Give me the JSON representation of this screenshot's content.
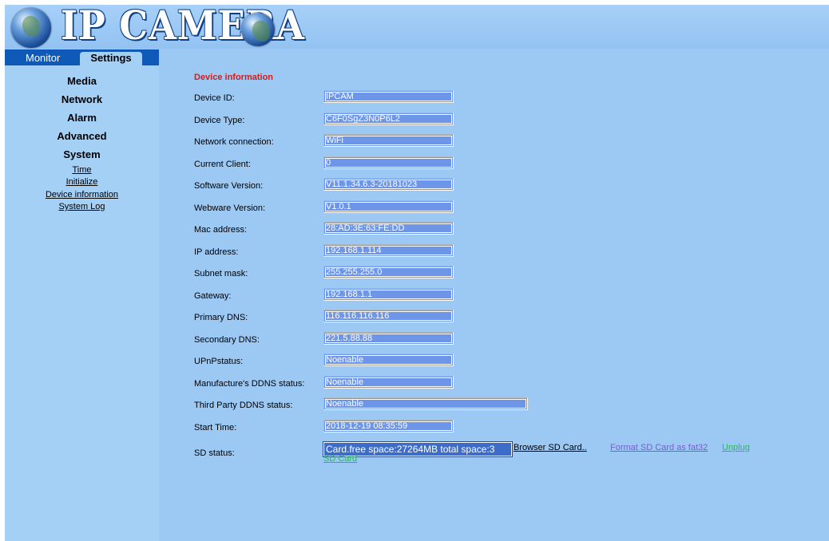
{
  "header": {
    "logo_text": "IP CAMERA"
  },
  "tabs": {
    "monitor": "Monitor",
    "settings": "Settings"
  },
  "nav": {
    "sections": [
      "Media",
      "Network",
      "Alarm",
      "Advanced",
      "System"
    ],
    "system_items": [
      "Time",
      "Initialize",
      "Device information",
      "System Log"
    ]
  },
  "content": {
    "title": "Device information",
    "rows": [
      {
        "label": "Device ID:",
        "value": "IPCAM"
      },
      {
        "label": "Device Type:",
        "value": "C6F0SgZ3N0P6L2"
      },
      {
        "label": "Network connection:",
        "value": "WiFi"
      },
      {
        "label": "Current Client:",
        "value": "0"
      },
      {
        "label": "Software Version:",
        "value": "V11.1.34.6.3-20181023"
      },
      {
        "label": "Webware Version:",
        "value": "V1.0.1"
      },
      {
        "label": "Mac address:",
        "value": "28:AD:3E:63:FE:DD"
      },
      {
        "label": "IP address:",
        "value": "192.168.1.114"
      },
      {
        "label": "Subnet mask:",
        "value": "255.255.255.0"
      },
      {
        "label": "Gateway:",
        "value": "192.168.1.1"
      },
      {
        "label": "Primary DNS:",
        "value": "116.116.116.116"
      },
      {
        "label": "Secondary DNS:",
        "value": "221.5.88.88"
      },
      {
        "label": "UPnPstatus:",
        "value": "Noenable"
      },
      {
        "label": "Manufacture's DDNS status:",
        "value": "Noenable"
      },
      {
        "label": "Third Party DDNS status:",
        "value": "Noenable"
      },
      {
        "label": "Start Time:",
        "value": "2018-12-19 08:35:59"
      }
    ],
    "sd": {
      "label": "SD status:",
      "value": "Card.free space:27264MB total space:3",
      "browse": "Browser SD Card..",
      "format": "Format SD Card as fat32",
      "unplug_1": "Unplug",
      "unplug_2": "SD Card"
    }
  },
  "colors": {
    "background": "#9cc8f4",
    "tab_bar": "#0f5ab8",
    "title_red": "#cc1f1f",
    "field_blue": "#6d96e8",
    "link_purple": "#7a5ed0",
    "link_green": "#22c04a"
  }
}
